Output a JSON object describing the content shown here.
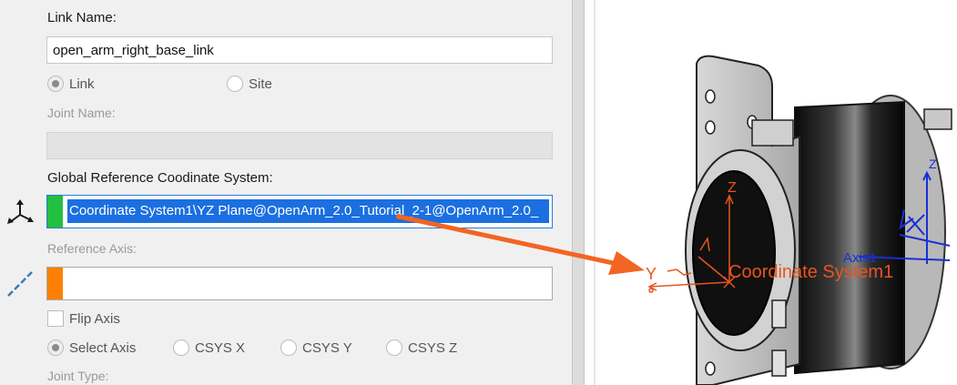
{
  "form": {
    "link_name_label": "Link Name:",
    "link_name_value": "open_arm_right_base_link",
    "type_radio": [
      {
        "label": "Link",
        "checked": true
      },
      {
        "label": "Site",
        "checked": false
      }
    ],
    "joint_name_label": "Joint Name:",
    "joint_name_value": "",
    "global_ref_label": "Global Reference Coodinate System:",
    "global_ref_value": "Coordinate System1\\YZ Plane@OpenArm_2.0_Tutorial_2-1@OpenArm_2.0_",
    "global_ref_color": "#22c040",
    "reference_axis_label": "Reference Axis:",
    "reference_axis_value": "",
    "reference_axis_color": "#ff7f00",
    "flip_axis_label": "Flip Axis",
    "flip_axis_checked": false,
    "axis_options": [
      {
        "label": "Select Axis",
        "checked": true
      },
      {
        "label": "CSYS X",
        "checked": false
      },
      {
        "label": "CSYS Y",
        "checked": false
      },
      {
        "label": "CSYS Z",
        "checked": false
      }
    ],
    "joint_type_label": "Joint Type:"
  },
  "icons": {
    "coordinate_system": "coordinate-system-icon",
    "axis": "axis-icon"
  },
  "viewport": {
    "csys_label": "Coordinate System1",
    "z_label": "Z",
    "y_label": "Y",
    "blue_z_label": "Z",
    "blue_axis_label": "Axis1",
    "csys_color": "#e8541e",
    "callout_arrow_color": "#f26522"
  }
}
